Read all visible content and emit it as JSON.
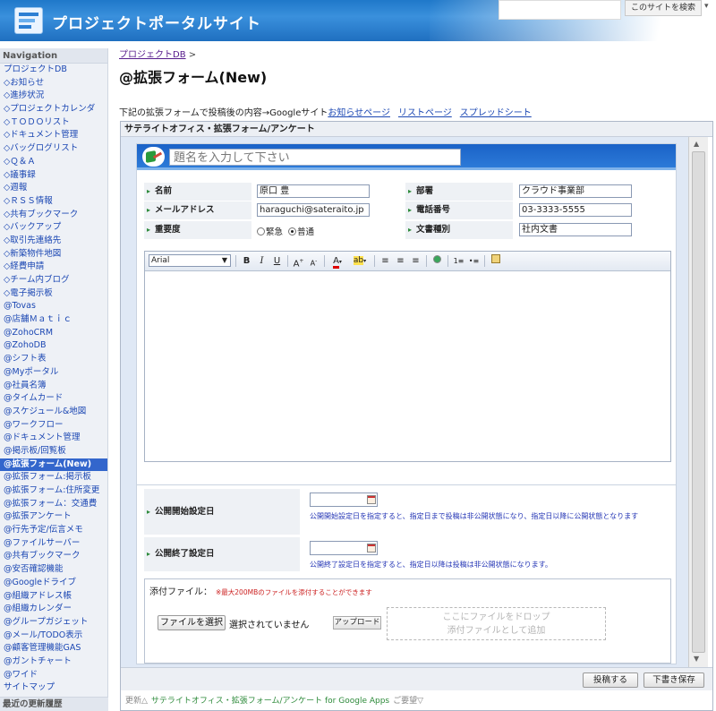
{
  "header": {
    "site_title": "プロジェクトポータルサイト",
    "search_button": "このサイトを検索",
    "dropdown": "▾"
  },
  "sidebar": {
    "title": "Navigation",
    "items": [
      {
        "label": "プロジェクトDB",
        "active": false
      },
      {
        "label": "◇お知らせ",
        "active": false
      },
      {
        "label": "◇進捗状況",
        "active": false
      },
      {
        "label": "◇プロジェクトカレンダ",
        "active": false
      },
      {
        "label": "◇ＴＯＤＯリスト",
        "active": false
      },
      {
        "label": "◇ドキュメント管理",
        "active": false
      },
      {
        "label": "◇バッグログリスト",
        "active": false
      },
      {
        "label": "◇Ｑ＆Ａ",
        "active": false
      },
      {
        "label": "◇議事録",
        "active": false
      },
      {
        "label": "◇週報",
        "active": false
      },
      {
        "label": "◇ＲＳＳ情報",
        "active": false
      },
      {
        "label": "◇共有ブックマーク",
        "active": false
      },
      {
        "label": "◇バックアップ",
        "active": false
      },
      {
        "label": "◇取引先連絡先",
        "active": false
      },
      {
        "label": "◇新築物件地図",
        "active": false
      },
      {
        "label": "◇経費申請",
        "active": false
      },
      {
        "label": "◇チーム内ブログ",
        "active": false
      },
      {
        "label": "◇電子掲示板",
        "active": false
      },
      {
        "label": "@Tovas",
        "active": false
      },
      {
        "label": "@店舗Ｍａｔｉｃ",
        "active": false
      },
      {
        "label": "@ZohoCRM",
        "active": false
      },
      {
        "label": "@ZohoDB",
        "active": false
      },
      {
        "label": "@シフト表",
        "active": false
      },
      {
        "label": "@Myポータル",
        "active": false
      },
      {
        "label": "@社員名簿",
        "active": false
      },
      {
        "label": "@タイムカード",
        "active": false
      },
      {
        "label": "@スケジュール&地図",
        "active": false
      },
      {
        "label": "@ワークフロー",
        "active": false
      },
      {
        "label": "@ドキュメント管理",
        "active": false
      },
      {
        "label": "@掲示板/回覧板",
        "active": false
      },
      {
        "label": "@拡張フォーム(New)",
        "active": true
      },
      {
        "label": "@拡張フォーム:掲示板",
        "active": false
      },
      {
        "label": "@拡張フォーム:住所変更",
        "active": false
      },
      {
        "label": "@拡張フォーム：交通費",
        "active": false
      },
      {
        "label": "@拡張アンケート",
        "active": false
      },
      {
        "label": "@行先予定/伝言メモ",
        "active": false
      },
      {
        "label": "@ファイルサーバー",
        "active": false
      },
      {
        "label": "@共有ブックマーク",
        "active": false
      },
      {
        "label": "@安否確認機能",
        "active": false
      },
      {
        "label": "@Googleドライブ",
        "active": false
      },
      {
        "label": "@組織アドレス帳",
        "active": false
      },
      {
        "label": "@組織カレンダー",
        "active": false
      },
      {
        "label": "@グループガジェット",
        "active": false
      },
      {
        "label": "@メール/TODO表示",
        "active": false
      },
      {
        "label": "@顧客管理機能GAS",
        "active": false
      },
      {
        "label": "@ガントチャート",
        "active": false
      },
      {
        "label": "@ワイド",
        "active": false
      },
      {
        "label": "サイトマップ",
        "active": false
      }
    ],
    "footer": "最近の更新履歴"
  },
  "main": {
    "breadcrumb_link": "プロジェクトDB",
    "breadcrumb_sep": ">",
    "page_title": "@拡張フォーム(New)",
    "intro_text": "下記の拡張フォームで投稿後の内容→Googleサイト",
    "intro_links": [
      "お知らせページ",
      "リストページ",
      "スプレッドシート"
    ]
  },
  "gadget": {
    "title": "サテライトオフィス・拡張フォーム/アンケート",
    "subject_placeholder": "題名を入力して下さい",
    "fields": {
      "name_label": "名前",
      "name_value": "原口 豊",
      "dept_label": "部署",
      "dept_value": "クラウド事業部",
      "email_label": "メールアドレス",
      "email_value": "haraguchi@sateraito.jp",
      "phone_label": "電話番号",
      "phone_value": "03-3333-5555",
      "priority_label": "重要度",
      "priority_options": [
        "緊急",
        "普通"
      ],
      "priority_selected": "普通",
      "doctype_label": "文書種別",
      "doctype_value": "社内文書"
    },
    "editor": {
      "font_name": "Arial",
      "tools": [
        "bold-icon",
        "italic-icon",
        "underline-icon",
        "font-size-up-icon",
        "font-size-down-icon",
        "text-color-icon",
        "highlight-icon",
        "align-left-icon",
        "align-center-icon",
        "align-right-icon",
        "image-icon",
        "numbered-list-icon",
        "bullet-list-icon",
        "html-edit-icon"
      ]
    },
    "publish": {
      "start_label": "公開開始設定日",
      "start_note": "公開開始設定日を指定すると、指定日まで投稿は非公開状態になり、指定日以降に公開状態となります",
      "end_label": "公開終了設定日",
      "end_note": "公開終了設定日を指定すると、指定日以降は投稿は非公開状態になります。"
    },
    "attachment": {
      "title": "添付ファイル：",
      "note": "※最大200MBのファイルを添付することができます",
      "choose_button": "ファイルを選択",
      "no_file": "選択されていません",
      "upload_button": "アップロード",
      "drop_line1": "ここにファイルをドロップ",
      "drop_line2": "添付ファイルとして追加"
    },
    "buttons": {
      "post": "投稿する",
      "draft": "下書き保存"
    },
    "footer": {
      "update": "更新△",
      "app_name": "サテライトオフィス・拡張フォーム/アンケート for Google Apps",
      "request": "ご要望▽"
    }
  }
}
